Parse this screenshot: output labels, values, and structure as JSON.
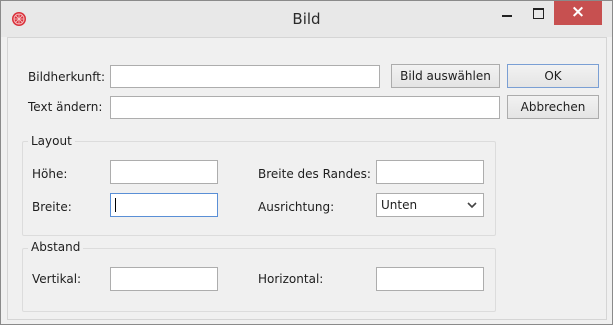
{
  "window": {
    "title": "Bild"
  },
  "controls": {
    "close_glyph": "×"
  },
  "form": {
    "source_label": "Bildherkunft:",
    "source_value": "",
    "choose_button": "Bild auswählen",
    "alt_label": "Text ändern:",
    "alt_value": ""
  },
  "buttons": {
    "ok": "OK",
    "cancel": "Abbrechen"
  },
  "layout": {
    "legend": "Layout",
    "height_label": "Höhe:",
    "height_value": "",
    "width_label": "Breite:",
    "width_value": "",
    "border_label": "Breite des Randes:",
    "border_value": "",
    "align_label": "Ausrichtung:",
    "align_value": "Unten"
  },
  "spacing": {
    "legend": "Abstand",
    "vertical_label": "Vertikal:",
    "vertical_value": "",
    "horizontal_label": "Horizontal:",
    "horizontal_value": ""
  },
  "colors": {
    "close_bg": "#c75050",
    "focus_border": "#5a8fd6",
    "icon_red": "#d9303a"
  }
}
